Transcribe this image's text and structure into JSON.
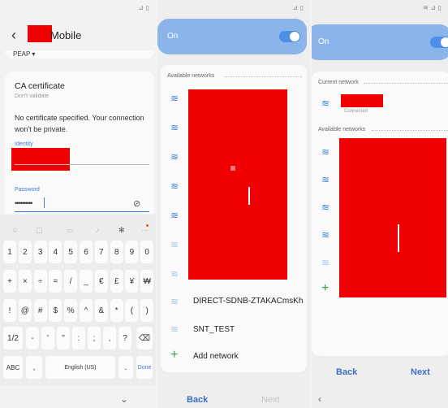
{
  "panel1": {
    "status_icons": "⊿ ▯",
    "title": "Mobile",
    "eap_value": "PEAP ▾",
    "ca_label": "CA certificate",
    "ca_value": "Don't validate",
    "warning": "No certificate specified. Your connection won't be private.",
    "identity_label": "Identity",
    "password_label": "Password",
    "password_value": "••••••••••",
    "keyboard": {
      "row1": [
        "1",
        "2",
        "3",
        "4",
        "5",
        "6",
        "7",
        "8",
        "9",
        "0"
      ],
      "row2": [
        "+",
        "×",
        "÷",
        "=",
        "/",
        "_",
        "€",
        "£",
        "¥",
        "₩"
      ],
      "row3": [
        "!",
        "@",
        "#",
        "$",
        "%",
        "^",
        "&",
        "*",
        "(",
        ")"
      ],
      "row4_left": "1/2",
      "row4": [
        "-",
        "'",
        "\"",
        ":",
        ";",
        ",",
        "?"
      ],
      "row5_left": "ABC",
      "row5_comma": ",",
      "space_label": "English (US)",
      "row5_dot": ".",
      "done_label": "Done"
    }
  },
  "panel2": {
    "status_icons": "⊿ ▯",
    "on_label": "On",
    "available_label": "Available networks",
    "networks": [
      {
        "name": "DIRECT-SDNB-ZTAKACmsKh"
      },
      {
        "name": "SNT_TEST"
      }
    ],
    "add_network": "Add network",
    "back": "Back",
    "next": "Next"
  },
  "panel3": {
    "status_icons": "≋ ⊿ ▯",
    "on_label": "On",
    "current_label": "Current network",
    "connected_label": "Connected",
    "available_label": "Available networks",
    "back": "Back",
    "next": "Next"
  },
  "colors": {
    "accent": "#3b83d6",
    "on_bar": "#8ab4ea",
    "redaction": "#f00000"
  }
}
